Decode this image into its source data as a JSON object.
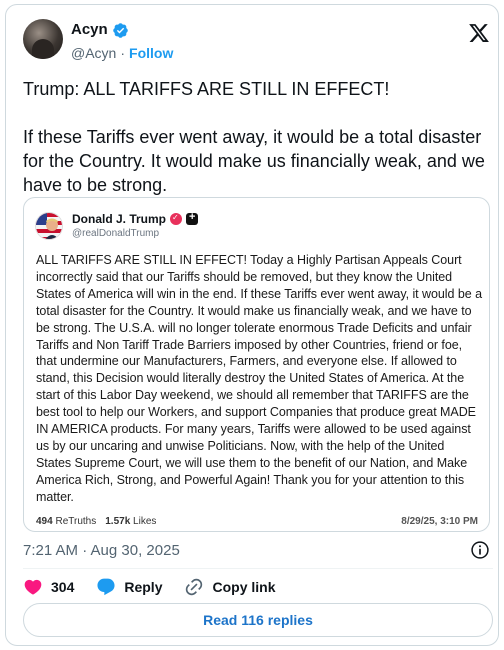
{
  "author": {
    "name": "Acyn",
    "handle": "@Acyn",
    "separator": "·",
    "follow_label": "Follow"
  },
  "tweet": {
    "text": "Trump: ALL TARIFFS ARE STILL IN EFFECT!\n\nIf these Tariffs ever went away, it would be a total disaster for the Country. It would make us financially weak, and we have to be strong."
  },
  "quote": {
    "name": "Donald J. Trump",
    "handle": "@realDonaldTrump",
    "body": "ALL TARIFFS ARE STILL IN EFFECT! Today a Highly Partisan Appeals Court incorrectly said that our Tariffs should be removed, but they know the United States of America will win in the end. If these Tariffs ever went away, it would be a total disaster for the Country. It would make us financially weak, and we have to be strong. The U.S.A. will no longer tolerate enormous Trade Deficits and unfair Tariffs and Non Tariff Trade Barriers imposed by other Countries, friend or foe, that undermine our Manufacturers, Farmers, and everyone else. If allowed to stand, this Decision would literally destroy the United States of America. At the start of this Labor Day weekend, we should all remember that TARIFFS are the best tool to help our Workers, and support Companies that produce great MADE IN AMERICA products. For many years, Tariffs were allowed to be used against us by our uncaring and unwise Politicians. Now, with the help of the United States Supreme Court, we will use them to the benefit of our Nation, and Make America Rich, Strong, and Powerful Again! Thank you for your attention to this matter.",
    "retruths_count": "494",
    "retruths_label": "ReTruths",
    "likes_count": "1.57k",
    "likes_label": "Likes",
    "date": "8/29/25, 3:10 PM"
  },
  "meta": {
    "timestamp": "7:21 AM · Aug 30, 2025"
  },
  "actions": {
    "like_count": "304",
    "reply_label": "Reply",
    "copy_link_label": "Copy link"
  },
  "footer": {
    "read_replies_label": "Read 116 replies"
  },
  "colors": {
    "accent_blue": "#1d9bf0",
    "like_pink": "#f91880",
    "truth_red": "#e8305b"
  },
  "icons": {
    "verified": "verified-badge-icon",
    "x_logo": "x-logo-icon",
    "info": "info-icon",
    "heart": "heart-icon",
    "reply": "speech-bubble-icon",
    "copy_link": "link-icon"
  }
}
